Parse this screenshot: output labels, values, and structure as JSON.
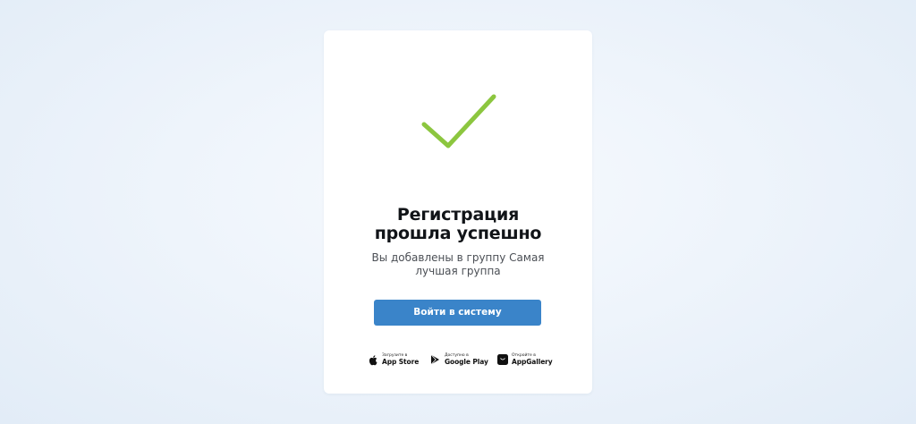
{
  "card": {
    "title": "Регистрация\nпрошла успешно",
    "subtitle": "Вы добавлены в группу Самая\nлучшая группа",
    "login_button": "Войти в систему"
  },
  "stores": [
    {
      "icon": "apple-icon",
      "caption": "Загрузите в",
      "name": "App Store"
    },
    {
      "icon": "google-play-icon",
      "caption": "Доступно в",
      "name": "Google Play"
    },
    {
      "icon": "appgallery-icon",
      "caption": "Откройте в",
      "name": "AppGallery"
    }
  ],
  "colors": {
    "check": "#8cc63f",
    "button": "#3a84c9",
    "title": "#111418",
    "subtitle": "#4b4f55"
  }
}
